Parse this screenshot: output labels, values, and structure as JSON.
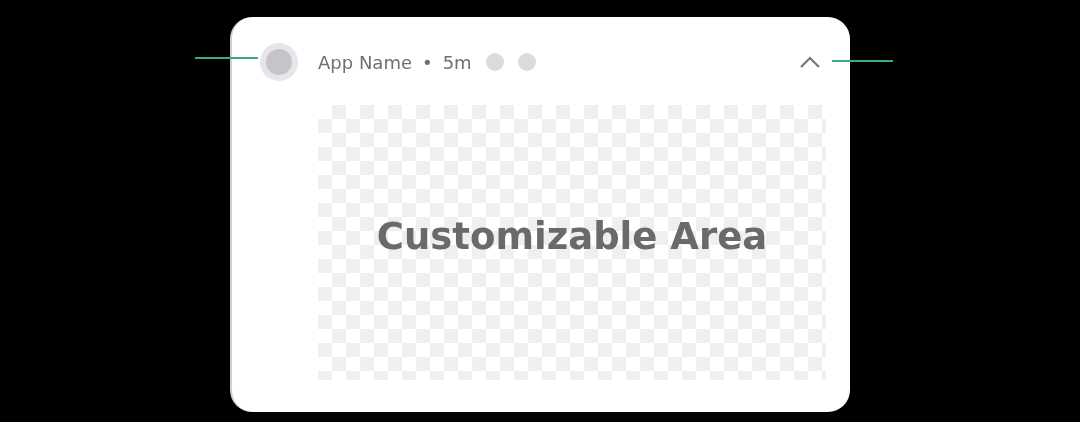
{
  "notification": {
    "app_name": "App Name",
    "separator": "•",
    "time": "5m",
    "expanded": true
  },
  "content": {
    "label": "Customizable Area"
  }
}
